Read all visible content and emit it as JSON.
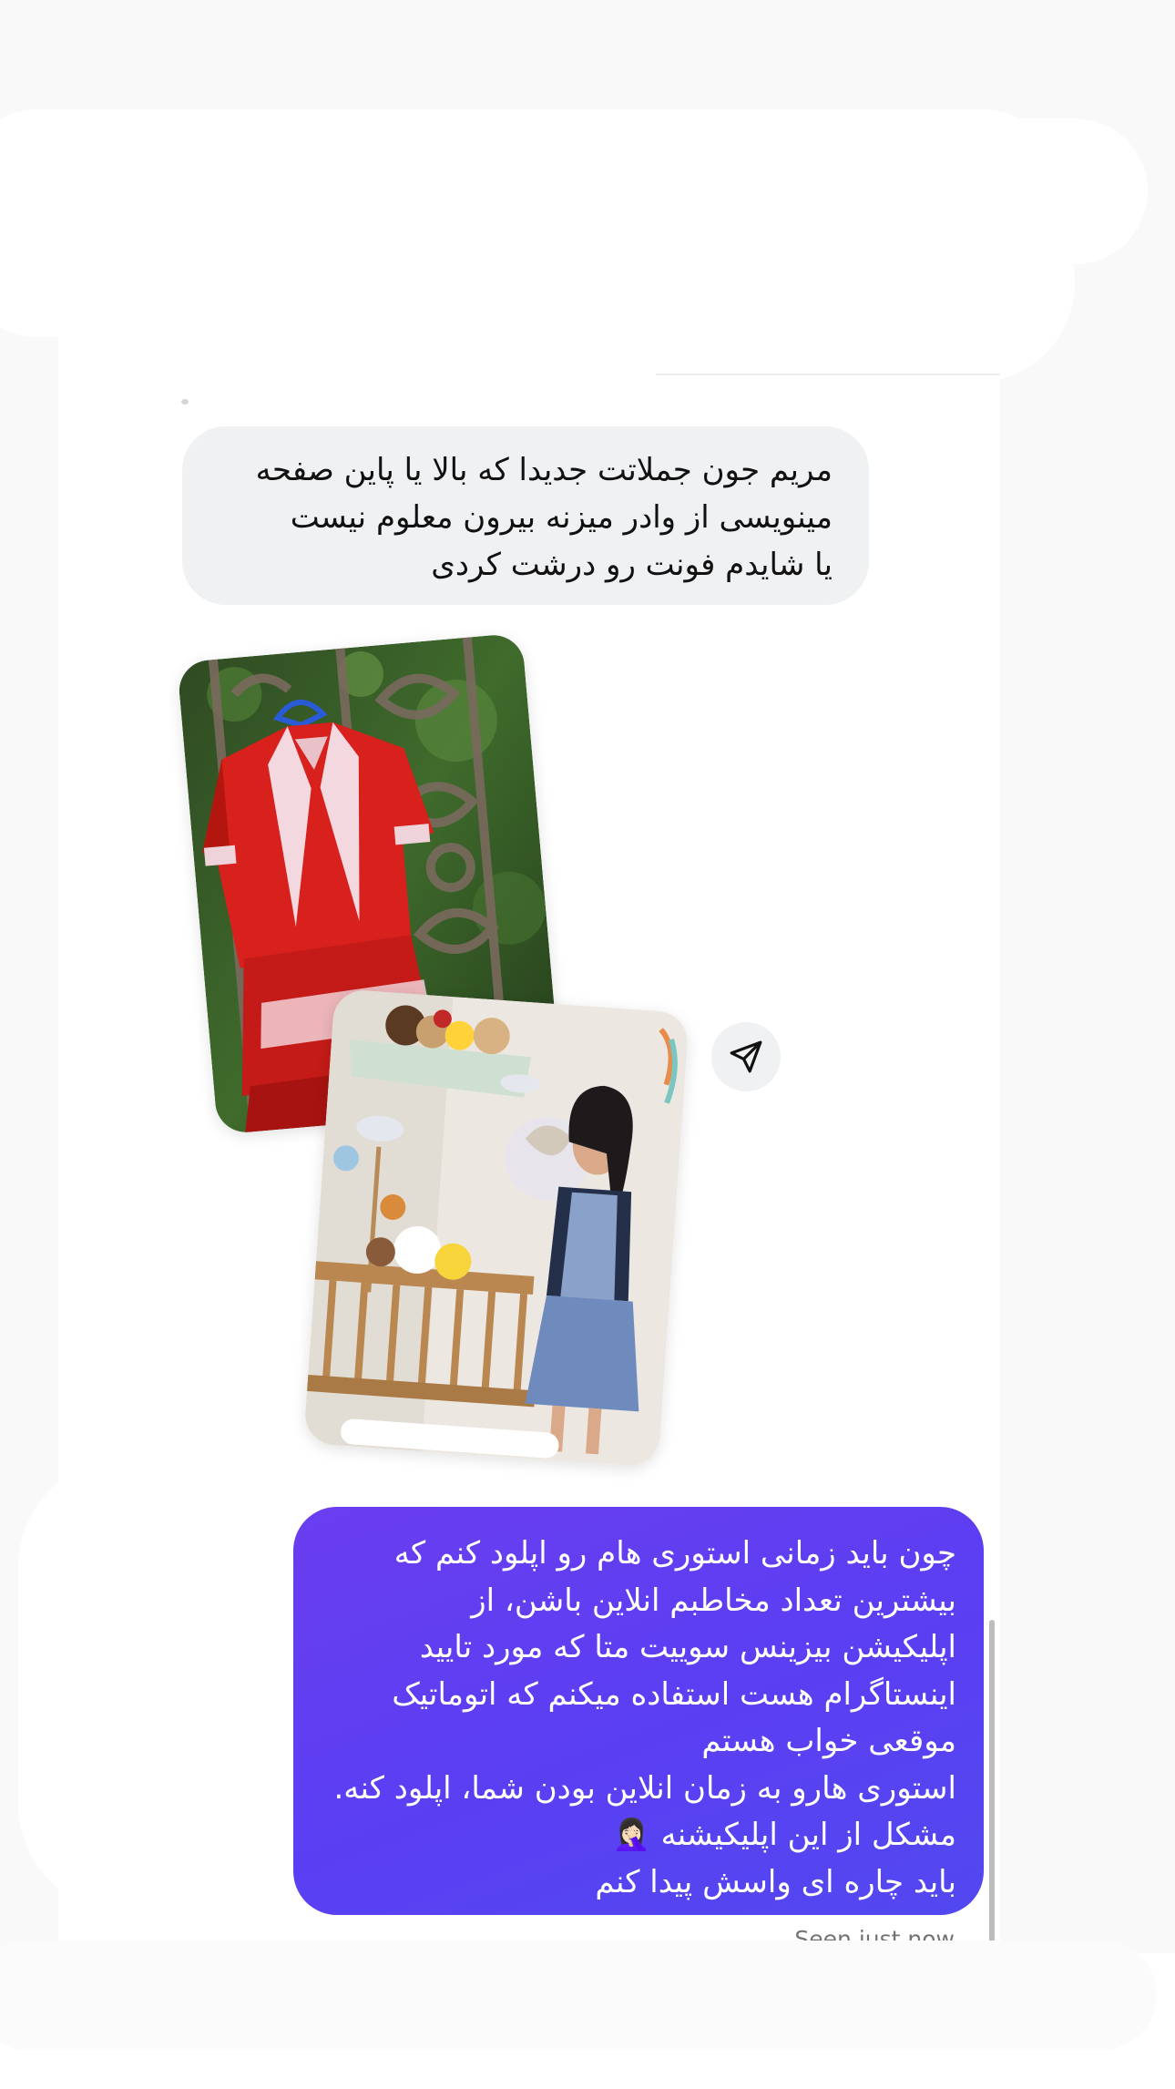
{
  "messages": {
    "incoming": {
      "text": "مریم جون جملاتت جدیدا که بالا یا پاین صفحه\nمینویسی از وادر میزنه بیرون معلوم نیست\nیا شایدم فونت رو درشت کردی"
    },
    "outgoing": {
      "text": "چون باید زمانی استوری هام رو اپلود کنم که\nبیشترین تعداد مخاطبم انلاین باشن، از\nاپلیکیشن بیزینس سوییت متا که مورد تایید\nاینستاگرام هست استفاده میکنم که اتوماتیک\nموقعی خواب هستم\nاستوری هارو به زمان انلاین بودن شما، اپلود کنه.\nمشکل از این اپلیکیشنه 🤦🏻‍♀️\nباید چاره ای واسش پیدا کنم"
    },
    "status": "Seen just now"
  },
  "attachments": {
    "share_icon": "paper-plane-icon"
  },
  "colors": {
    "incoming_bubble": "#eff1f3",
    "outgoing_bubble": "#5b40f2",
    "seen_text": "#737373"
  }
}
